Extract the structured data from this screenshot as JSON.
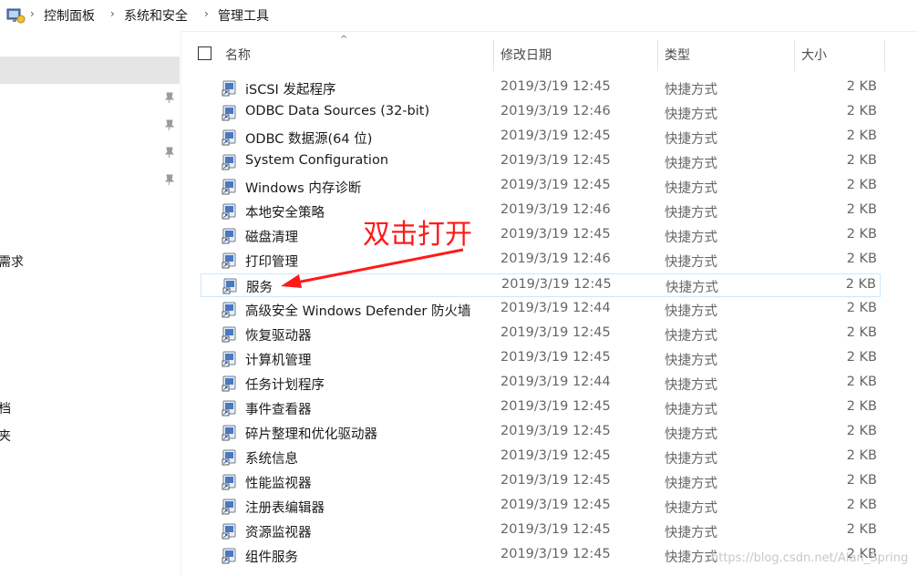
{
  "breadcrumb": {
    "items": [
      "控制面板",
      "系统和安全",
      "管理工具"
    ],
    "separator": "›",
    "icon": "control-panel-icon"
  },
  "sidebar": {
    "partial_labels": [
      "需求",
      "档",
      "夹"
    ],
    "pin_icon": "pin-icon"
  },
  "columns": {
    "name": "名称",
    "modified": "修改日期",
    "type": "类型",
    "size": "大小"
  },
  "files": [
    {
      "name": "iSCSI 发起程序",
      "date": "2019/3/19 12:45",
      "type": "快捷方式",
      "size": "2 KB",
      "icon": "iscsi-icon"
    },
    {
      "name": "ODBC Data Sources (32-bit)",
      "date": "2019/3/19 12:46",
      "type": "快捷方式",
      "size": "2 KB",
      "icon": "odbc-icon"
    },
    {
      "name": "ODBC 数据源(64 位)",
      "date": "2019/3/19 12:45",
      "type": "快捷方式",
      "size": "2 KB",
      "icon": "odbc-icon"
    },
    {
      "name": "System Configuration",
      "date": "2019/3/19 12:45",
      "type": "快捷方式",
      "size": "2 KB",
      "icon": "system-configuration-icon"
    },
    {
      "name": "Windows 内存诊断",
      "date": "2019/3/19 12:45",
      "type": "快捷方式",
      "size": "2 KB",
      "icon": "memory-diagnostic-icon"
    },
    {
      "name": "本地安全策略",
      "date": "2019/3/19 12:46",
      "type": "快捷方式",
      "size": "2 KB",
      "icon": "security-policy-icon"
    },
    {
      "name": "磁盘清理",
      "date": "2019/3/19 12:45",
      "type": "快捷方式",
      "size": "2 KB",
      "icon": "disk-cleanup-icon"
    },
    {
      "name": "打印管理",
      "date": "2019/3/19 12:46",
      "type": "快捷方式",
      "size": "2 KB",
      "icon": "print-management-icon"
    },
    {
      "name": "服务",
      "date": "2019/3/19 12:45",
      "type": "快捷方式",
      "size": "2 KB",
      "icon": "services-icon"
    },
    {
      "name": "高级安全 Windows Defender 防火墙",
      "date": "2019/3/19 12:44",
      "type": "快捷方式",
      "size": "2 KB",
      "icon": "firewall-icon"
    },
    {
      "name": "恢复驱动器",
      "date": "2019/3/19 12:45",
      "type": "快捷方式",
      "size": "2 KB",
      "icon": "recovery-drive-icon"
    },
    {
      "name": "计算机管理",
      "date": "2019/3/19 12:45",
      "type": "快捷方式",
      "size": "2 KB",
      "icon": "computer-management-icon"
    },
    {
      "name": "任务计划程序",
      "date": "2019/3/19 12:44",
      "type": "快捷方式",
      "size": "2 KB",
      "icon": "task-scheduler-icon"
    },
    {
      "name": "事件查看器",
      "date": "2019/3/19 12:45",
      "type": "快捷方式",
      "size": "2 KB",
      "icon": "event-viewer-icon"
    },
    {
      "name": "碎片整理和优化驱动器",
      "date": "2019/3/19 12:45",
      "type": "快捷方式",
      "size": "2 KB",
      "icon": "defragment-icon"
    },
    {
      "name": "系统信息",
      "date": "2019/3/19 12:45",
      "type": "快捷方式",
      "size": "2 KB",
      "icon": "system-information-icon"
    },
    {
      "name": "性能监视器",
      "date": "2019/3/19 12:45",
      "type": "快捷方式",
      "size": "2 KB",
      "icon": "performance-monitor-icon"
    },
    {
      "name": "注册表编辑器",
      "date": "2019/3/19 12:45",
      "type": "快捷方式",
      "size": "2 KB",
      "icon": "registry-editor-icon"
    },
    {
      "name": "资源监视器",
      "date": "2019/3/19 12:45",
      "type": "快捷方式",
      "size": "2 KB",
      "icon": "resource-monitor-icon"
    },
    {
      "name": "组件服务",
      "date": "2019/3/19 12:45",
      "type": "快捷方式",
      "size": "2 KB",
      "icon": "component-services-icon"
    }
  ],
  "annotation": {
    "text": "双击打开",
    "color": "#ff1a1a",
    "target": "服务"
  },
  "watermark": "https://blog.csdn.net/Alan_Spring",
  "colors": {
    "selection": "#cce8ff",
    "sidebar_selected": "#e5e5e5",
    "annotation": "#ff1a1a"
  }
}
